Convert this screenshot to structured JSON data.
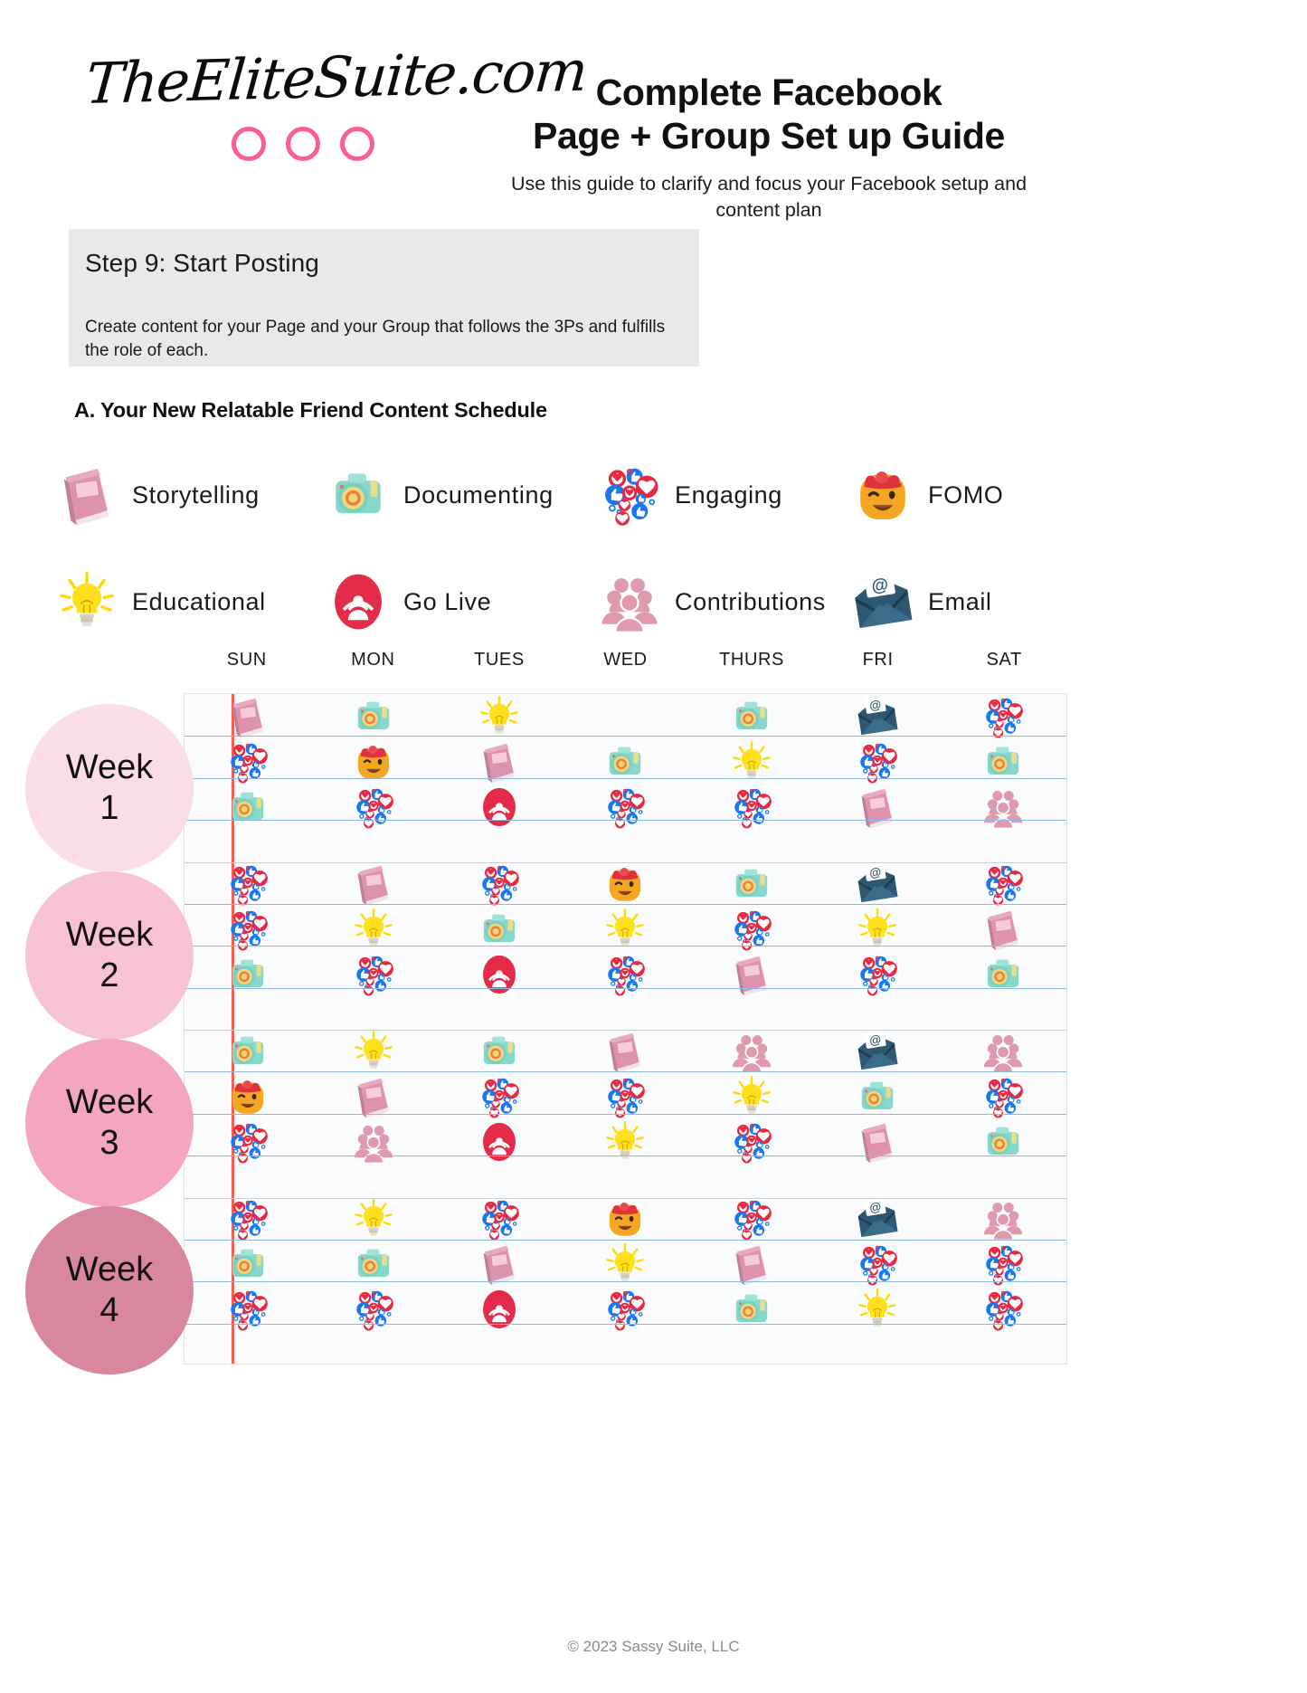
{
  "brand": {
    "logo_text": "TheEliteSuite.com",
    "logo_dots": 3,
    "dot_color": "#fb5e96"
  },
  "header": {
    "title_line1": "Complete Facebook",
    "title_line2": "Page + Group Set up Guide",
    "subtitle": "Use this guide to clarify and focus your Facebook setup and content plan"
  },
  "step": {
    "title": "Step 9: Start Posting",
    "body": "Create content for your Page and your Group that follows the 3Ps and fulfills the role of each.",
    "background": "#e9e9e9"
  },
  "section": {
    "heading": "A. Your New Relatable Friend Content Schedule"
  },
  "legend": {
    "row1": [
      {
        "key": "storytelling",
        "label": "Storytelling",
        "icon": "book-icon",
        "color": "#e3a0b8"
      },
      {
        "key": "documenting",
        "label": "Documenting",
        "icon": "camera-icon",
        "color": "#7ed3c8"
      },
      {
        "key": "engaging",
        "label": "Engaging",
        "icon": "reactions-icon",
        "color": "#1877f2"
      },
      {
        "key": "fomo",
        "label": "FOMO",
        "icon": "wink-face-icon",
        "color": "#f5a623"
      }
    ],
    "row2": [
      {
        "key": "educational",
        "label": "Educational",
        "icon": "lightbulb-icon",
        "color": "#ffd900"
      },
      {
        "key": "golive",
        "label": "Go Live",
        "icon": "broadcast-icon",
        "color": "#e41e3f"
      },
      {
        "key": "contributions",
        "label": "Contributions",
        "icon": "people-group-icon",
        "color": "#e09aae"
      },
      {
        "key": "email",
        "label": "Email",
        "icon": "envelope-at-icon",
        "color": "#2d5872"
      }
    ]
  },
  "calendar": {
    "days": [
      "SUN",
      "MON",
      "TUES",
      "WED",
      "THURS",
      "FRI",
      "SAT"
    ],
    "weeks": [
      {
        "label": "Week",
        "number": "1",
        "color": "#fbdde6"
      },
      {
        "label": "Week",
        "number": "2",
        "color": "#f7c2d4"
      },
      {
        "label": "Week",
        "number": "3",
        "color": "#f4a6c1"
      },
      {
        "label": "Week",
        "number": "4",
        "color": "#d9879f"
      }
    ],
    "rows": [
      [
        "storytelling",
        "documenting",
        "educational",
        "",
        "documenting",
        "email",
        "engaging"
      ],
      [
        "engaging",
        "fomo",
        "storytelling",
        "documenting",
        "educational",
        "engaging",
        "documenting"
      ],
      [
        "documenting",
        "engaging",
        "golive",
        "engaging",
        "engaging",
        "storytelling",
        "contributions"
      ],
      [
        "",
        "",
        "",
        "",
        "",
        "",
        ""
      ],
      [
        "engaging",
        "storytelling",
        "engaging",
        "fomo",
        "documenting",
        "email",
        "engaging"
      ],
      [
        "engaging",
        "educational",
        "documenting",
        "educational",
        "engaging",
        "educational",
        "storytelling"
      ],
      [
        "documenting",
        "engaging",
        "golive",
        "engaging",
        "storytelling",
        "engaging",
        "documenting"
      ],
      [
        "",
        "",
        "",
        "",
        "",
        "",
        ""
      ],
      [
        "documenting",
        "educational",
        "documenting",
        "storytelling",
        "contributions",
        "email",
        "contributions"
      ],
      [
        "fomo",
        "storytelling",
        "engaging",
        "engaging",
        "educational",
        "documenting",
        "engaging"
      ],
      [
        "engaging",
        "contributions",
        "golive",
        "educational",
        "engaging",
        "storytelling",
        "documenting"
      ],
      [
        "",
        "",
        "",
        "",
        "",
        "",
        ""
      ],
      [
        "engaging",
        "educational",
        "engaging",
        "fomo",
        "engaging",
        "email",
        "contributions"
      ],
      [
        "documenting",
        "documenting",
        "storytelling",
        "educational",
        "storytelling",
        "engaging",
        "engaging"
      ],
      [
        "engaging",
        "engaging",
        "golive",
        "engaging",
        "documenting",
        "educational",
        "engaging"
      ],
      [
        "",
        "",
        "",
        "",
        "",
        "",
        ""
      ]
    ]
  },
  "footer": {
    "copyright": "© 2023 Sassy Suite, LLC"
  }
}
